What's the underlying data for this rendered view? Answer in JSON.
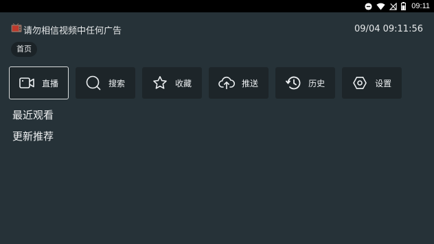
{
  "status_bar": {
    "time": "09:11"
  },
  "header": {
    "notice": "请勿相信视频中任何广告",
    "datetime": "09/04 09:11:56"
  },
  "tabs": [
    {
      "label": "首页",
      "selected": true
    }
  ],
  "nav": [
    {
      "label": "直播",
      "icon": "video-camera-icon",
      "focused": true
    },
    {
      "label": "搜索",
      "icon": "search-icon"
    },
    {
      "label": "收藏",
      "icon": "star-icon"
    },
    {
      "label": "推送",
      "icon": "cloud-upload-icon"
    },
    {
      "label": "历史",
      "icon": "history-icon"
    },
    {
      "label": "设置",
      "icon": "settings-icon"
    }
  ],
  "sections": {
    "recent": "最近观看",
    "updates": "更新推荐"
  },
  "colors": {
    "background": "#263238",
    "button_bg": "#1d2529",
    "focus_border": "#d9dcdd"
  }
}
